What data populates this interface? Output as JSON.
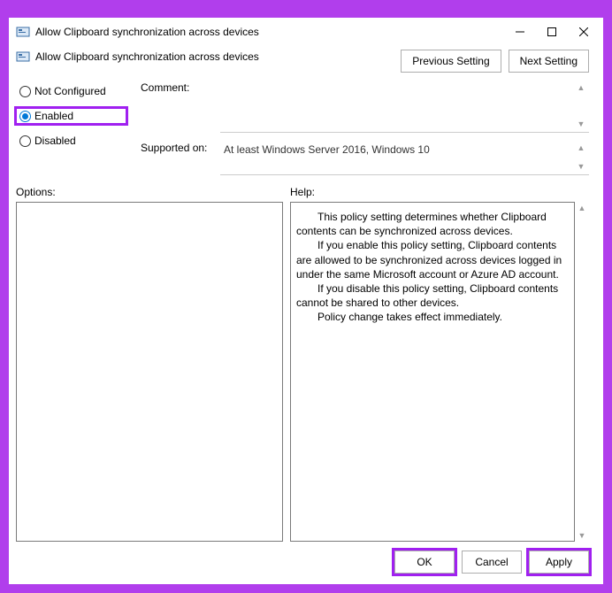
{
  "window": {
    "title": "Allow Clipboard synchronization across devices"
  },
  "header": {
    "policy_title": "Allow Clipboard synchronization across devices",
    "prev_label": "Previous Setting",
    "next_label": "Next Setting"
  },
  "state": {
    "not_configured_label": "Not Configured",
    "enabled_label": "Enabled",
    "disabled_label": "Disabled",
    "selected": "enabled"
  },
  "fields": {
    "comment_label": "Comment:",
    "comment_value": "",
    "supported_label": "Supported on:",
    "supported_value": "At least Windows Server 2016, Windows 10"
  },
  "panels": {
    "options_label": "Options:",
    "help_label": "Help:"
  },
  "help_text": {
    "p1": "This policy setting determines whether Clipboard contents can be synchronized across devices.",
    "p2": "If you enable this policy setting, Clipboard contents are allowed to be synchronized across devices logged in under the same Microsoft account or Azure AD account.",
    "p3": "If you disable this policy setting, Clipboard contents cannot be shared to other devices.",
    "p4": "Policy change takes effect immediately."
  },
  "footer": {
    "ok_label": "OK",
    "cancel_label": "Cancel",
    "apply_label": "Apply"
  }
}
